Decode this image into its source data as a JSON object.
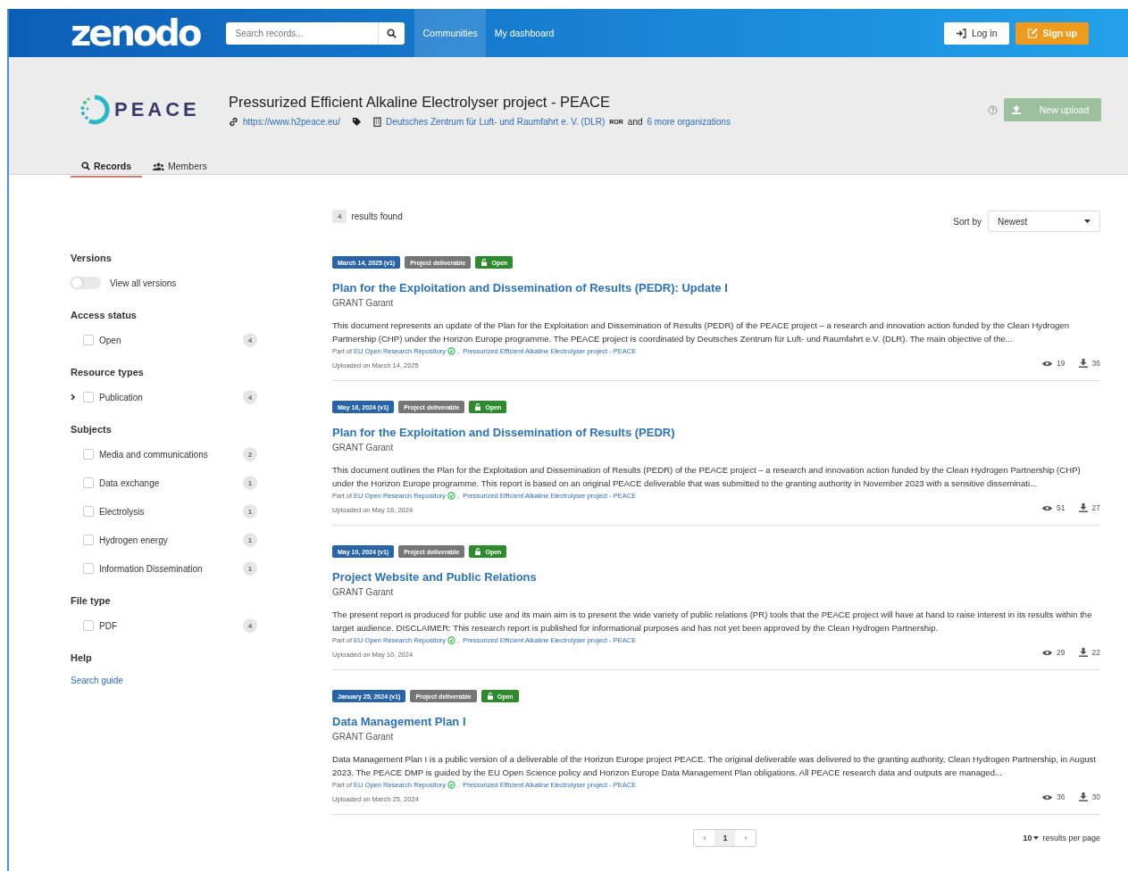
{
  "header": {
    "logo": "zenodo",
    "search": {
      "placeholder": "Search records..."
    },
    "nav": [
      {
        "label": "Communities",
        "selected": true
      },
      {
        "label": "My dashboard",
        "selected": false
      }
    ],
    "login": "Log in",
    "signup": "Sign up"
  },
  "community": {
    "logo": "PEACE",
    "title": "Pressurized Efficient Alkaline Electrolyser project - PEACE",
    "website": "https://www.h2peace.eu/",
    "organization": "Deutsches Zentrum für Luft- und Raumfahrt e. V. (DLR)",
    "ror": "ROR",
    "and": "and",
    "more": "6 more organizations",
    "new_upload": {
      "label": "New upload",
      "disabled": true
    },
    "tabs": [
      {
        "label": "Records",
        "selected": true
      },
      {
        "label": "Members",
        "selected": false
      }
    ]
  },
  "facets": {
    "versions": {
      "title": "Versions",
      "toggle": {
        "label": "View all versions",
        "on": false
      }
    },
    "groups": [
      {
        "title": "Access status",
        "items": [
          {
            "label": "Open",
            "count": "4",
            "checked": false,
            "expandable": false
          }
        ]
      },
      {
        "title": "Resource types",
        "items": [
          {
            "label": "Publication",
            "count": "4",
            "checked": false,
            "expandable": true
          }
        ]
      },
      {
        "title": "Subjects",
        "items": [
          {
            "label": "Media and communications",
            "count": "2",
            "checked": false,
            "expandable": false
          },
          {
            "label": "Data exchange",
            "count": "1",
            "checked": false,
            "expandable": false
          },
          {
            "label": "Electrolysis",
            "count": "1",
            "checked": false,
            "expandable": false
          },
          {
            "label": "Hydrogen energy",
            "count": "1",
            "checked": false,
            "expandable": false
          },
          {
            "label": "Information Dissemination",
            "count": "1",
            "checked": false,
            "expandable": false
          }
        ]
      },
      {
        "title": "File type",
        "items": [
          {
            "label": "PDF",
            "count": "4",
            "checked": false,
            "expandable": false
          }
        ]
      }
    ],
    "help": {
      "title": "Help",
      "link": "Search guide"
    }
  },
  "results": {
    "count": "4",
    "count_label": "results found",
    "sort_label": "Sort by",
    "sort_value": "Newest",
    "records": [
      {
        "date": "March 14, 2025 (v1)",
        "type": "Project deliverable",
        "access": "Open",
        "title": "Plan for the Exploitation and Dissemination of Results (PEDR): Update I",
        "creator": "GRANT Garant",
        "description": "This document represents an update of the Plan for the Exploitation and Dissemination of Results (PEDR) of the PEACE project – a research and innovation action funded by the Clean Hydrogen Partnership (CHP) under the Horizon Europe programme. The PEACE project is coordinated by Deutsches Zentrum für Luft- und Raumfahrt e.V. (DLR). The main objective of the...",
        "part_of": "Part of",
        "communities": [
          "EU Open Research Repository",
          "Pressurized Efficient Alkaline Electrolyser project - PEACE"
        ],
        "separator": ",",
        "uploaded": "Uploaded on March 14, 2025",
        "views": "19",
        "downloads": "36"
      },
      {
        "date": "May 16, 2024 (v1)",
        "type": "Project deliverable",
        "access": "Open",
        "title": "Plan for the Exploitation and Dissemination of Results (PEDR)",
        "creator": "GRANT Garant",
        "description": "This document outlines the Plan for the Exploitation and Dissemination of Results (PEDR) of the PEACE project – a research and innovation action funded by the Clean Hydrogen Partnership (CHP) under the Horizon Europe programme. This report is based on an original PEACE deliverable that was submitted to the granting authority in November 2023 with a sensitive disseminati...",
        "part_of": "Part of",
        "communities": [
          "EU Open Research Repository",
          "Pressurized Efficient Alkaline Electrolyser project - PEACE"
        ],
        "separator": ",",
        "uploaded": "Uploaded on May 16, 2024",
        "views": "51",
        "downloads": "27"
      },
      {
        "date": "May 10, 2024 (v1)",
        "type": "Project deliverable",
        "access": "Open",
        "title": "Project Website and Public Relations",
        "creator": "GRANT Garant",
        "description": "The present report is produced for public use and its main aim is to present the wide variety of public relations (PR) tools that the PEACE project will have at hand to raise interest in its results within the target audience. DISCLAIMER: This research report is published for informational purposes and has not yet been approved by the Clean Hydrogen Partnership.",
        "part_of": "Part of",
        "communities": [
          "EU Open Research Repository",
          "Pressurized Efficient Alkaline Electrolyser project - PEACE"
        ],
        "separator": ",",
        "uploaded": "Uploaded on May 10, 2024",
        "views": "29",
        "downloads": "22"
      },
      {
        "date": "January 25, 2024 (v1)",
        "type": "Project deliverable",
        "access": "Open",
        "title": "Data Management Plan I",
        "creator": "GRANT Garant",
        "description": "Data Management Plan I is a public version of a deliverable of the Horizon Europe project PEACE. The original deliverable was delivered to the granting authority, Clean Hydrogen Partnership, in August 2023.   The PEACE DMP is guided by the EU Open Science policy and Horizon Europe Data Management Plan obligations. All PEACE research data and outputs are managed...",
        "part_of": "Part of",
        "communities": [
          "EU Open Research Repository",
          "Pressurized Efficient Alkaline Electrolyser project - PEACE"
        ],
        "separator": ",",
        "uploaded": "Uploaded on March 25, 2024",
        "views": "36",
        "downloads": "30"
      }
    ],
    "pagination": {
      "prev": "‹",
      "pages": [
        {
          "label": "1",
          "selected": true
        }
      ],
      "next": "›"
    },
    "per_page": "10",
    "per_page_label": "results per page"
  }
}
